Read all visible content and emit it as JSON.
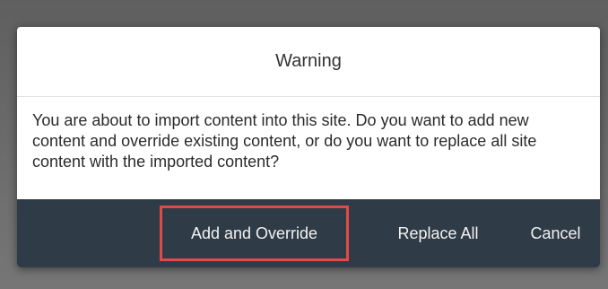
{
  "dialog": {
    "title": "Warning",
    "message": "You are about to import content into this site. Do you want to add new content and override existing content, or do you want to replace all site content with the imported content?",
    "buttons": {
      "add_override": "Add and Override",
      "replace_all": "Replace All",
      "cancel": "Cancel"
    }
  },
  "colors": {
    "footer_background": "#2f3b46",
    "highlight_border": "#e14b46",
    "dialog_background": "#ffffff"
  }
}
